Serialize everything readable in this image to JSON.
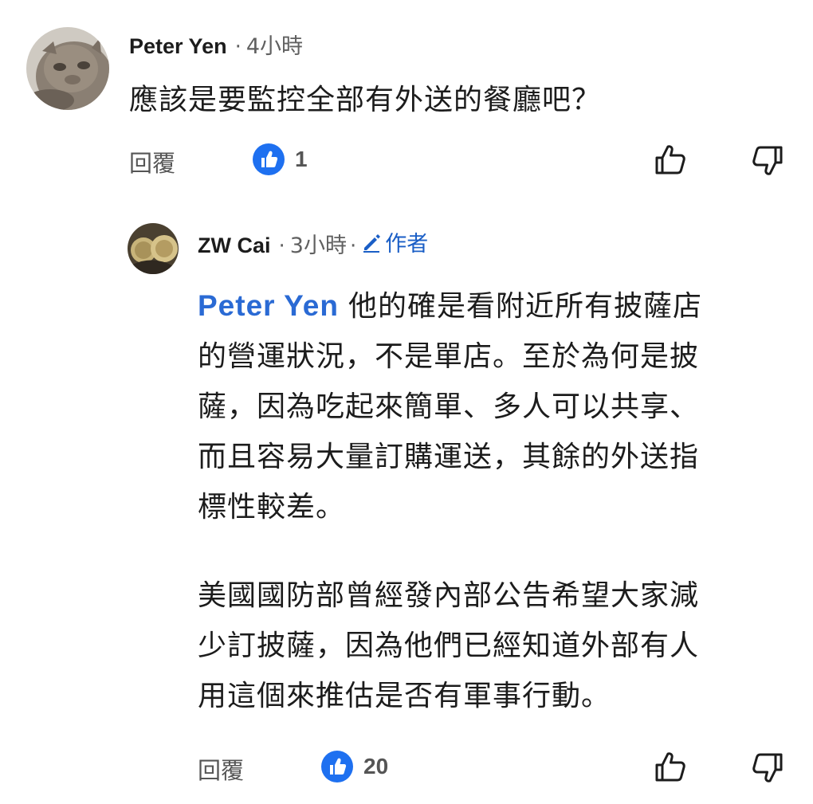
{
  "comments": [
    {
      "author": "Peter Yen",
      "separator": "·",
      "time": "4小時",
      "avatar_icon": "cat-avatar",
      "text": "應該是要監控全部有外送的餐廳吧？",
      "reply_label": "回覆",
      "like_count": "1",
      "like_icon": "like-reaction-icon",
      "thumb_up_icon": "thumbs-up-icon",
      "thumb_down_icon": "thumbs-down-icon"
    },
    {
      "author": "ZW Cai",
      "separator": "·",
      "time": "3小時",
      "separator2": "·",
      "badge": "作者",
      "badge_icon": "pencil-icon",
      "avatar_icon": "user-avatar",
      "mention": "Peter Yen",
      "lines": [
        "他的確是看附近所有披薩店",
        "的營運狀況，不是單店。至於為何是披",
        "薩，因為吃起來簡單、多人可以共享、",
        "而且容易大量訂購運送，其餘的外送指",
        "標性較差。",
        "美國國防部曾經發內部公告希望大家減",
        "少訂披薩，因為他們已經知道外部有人",
        "用這個來推估是否有軍事行動。"
      ],
      "reply_label": "回覆",
      "like_count": "20",
      "like_icon": "like-reaction-icon",
      "thumb_up_icon": "thumbs-up-icon",
      "thumb_down_icon": "thumbs-down-icon"
    }
  ],
  "colors": {
    "like_blue": "#1e70f0",
    "mention_blue": "#2a6ad4",
    "badge_blue": "#1a5ec6",
    "text": "#1c1c1c",
    "muted": "#606060"
  }
}
